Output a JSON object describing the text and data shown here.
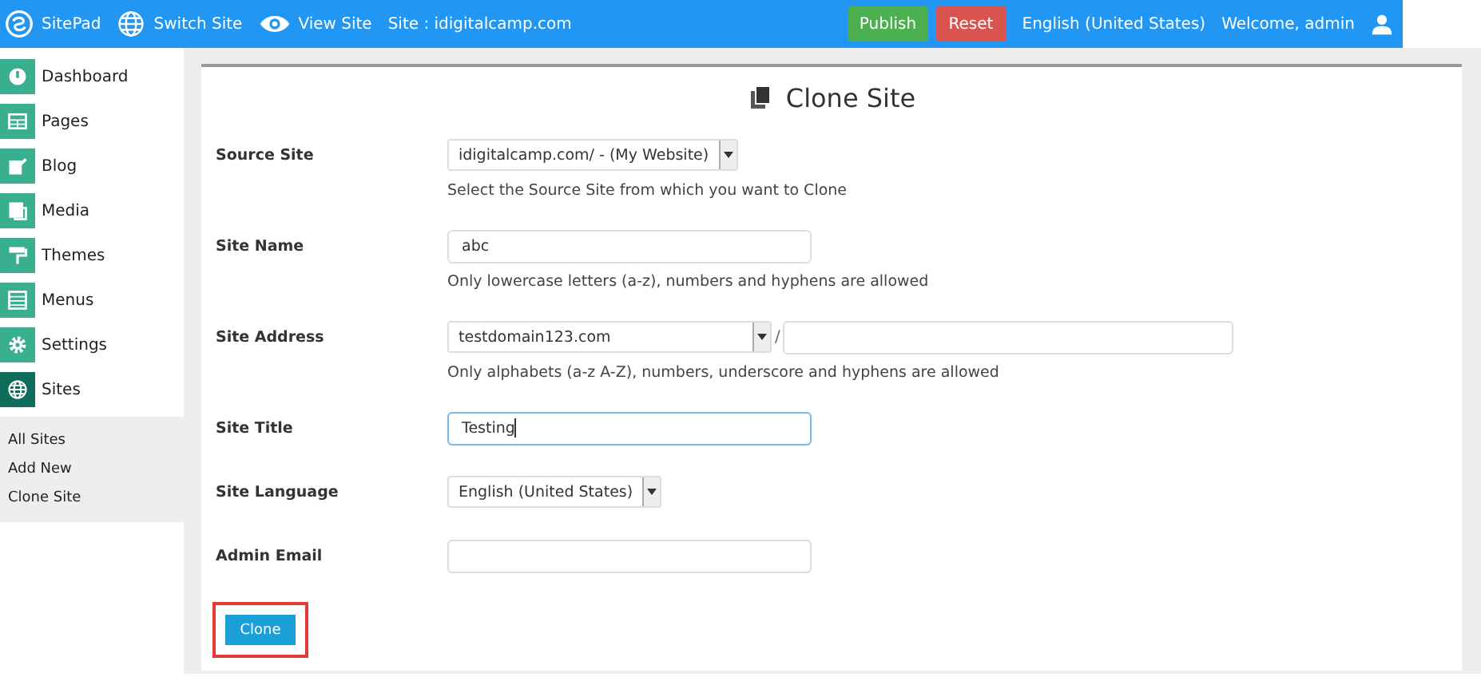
{
  "topbar": {
    "brand": "SitePad",
    "links": [
      "Switch Site",
      "View Site"
    ],
    "site": "Site : idigitalcamp.com",
    "publish": "Publish",
    "reset": "Reset",
    "language": "English (United States)",
    "welcome": "Welcome, admin"
  },
  "sidebar": {
    "items": [
      {
        "label": "Dashboard",
        "selected": false
      },
      {
        "label": "Pages",
        "selected": false
      },
      {
        "label": "Blog",
        "selected": false
      },
      {
        "label": "Media",
        "selected": false
      },
      {
        "label": "Themes",
        "selected": false
      },
      {
        "label": "Menus",
        "selected": false
      },
      {
        "label": "Settings",
        "selected": false
      },
      {
        "label": "Sites",
        "selected": true
      }
    ],
    "subitems": [
      "All Sites",
      "Add New",
      "Clone Site"
    ]
  },
  "form": {
    "title": "Clone Site",
    "fields": [
      {
        "label": "Source Site",
        "kind": "select",
        "value": "idigitalcamp.com/ - (My Website)",
        "help": "Select the Source Site from which you want to Clone"
      },
      {
        "label": "Site Name",
        "kind": "text",
        "value": "abc",
        "focused": false,
        "help": "Only lowercase letters (a-z), numbers and hyphens are allowed"
      },
      {
        "label": "Site Address",
        "kind": "address",
        "value": "testdomain123.com",
        "separator": "/",
        "help": "Only alphabets (a-z A-Z), numbers, underscore and hyphens are allowed"
      },
      {
        "label": "Site Title",
        "kind": "text",
        "value": "Testing",
        "focused": true
      },
      {
        "label": "Site Language",
        "kind": "select",
        "value": "English (United States)"
      },
      {
        "label": "Admin Email",
        "kind": "text",
        "focused": false
      }
    ],
    "submit": {
      "label": "Clone",
      "highlighted": true
    }
  }
}
